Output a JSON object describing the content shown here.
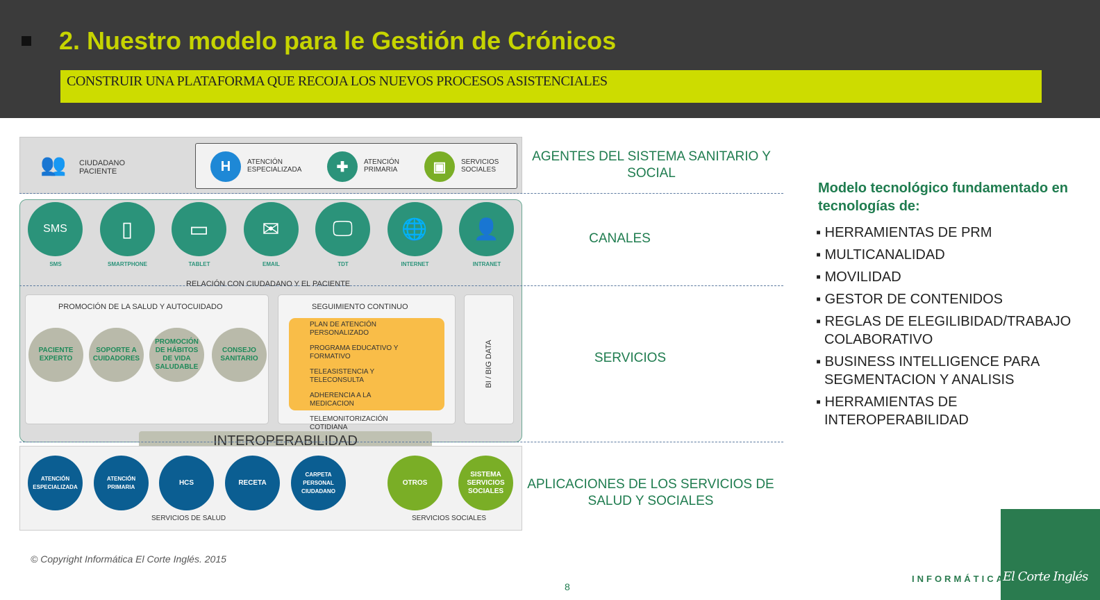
{
  "header": {
    "title": "2. Nuestro modelo para le Gestión de Crónicos",
    "subtitle": "CONSTRUIR UNA PLATAFORMA QUE RECOJA LOS NUEVOS PROCESOS ASISTENCIALES"
  },
  "agents": {
    "citizen": "CIUDADANO PACIENTE",
    "items": [
      {
        "label": "ATENCIÓN ESPECIALIZADA",
        "icon": "hospital-icon",
        "color": "#1e88d6"
      },
      {
        "label": "ATENCIÓN PRIMARIA",
        "icon": "medical-kit-icon",
        "color": "#2b937a"
      },
      {
        "label": "SERVICIOS SOCIALES",
        "icon": "social-services-icon",
        "color": "#7aae26"
      }
    ]
  },
  "channels": {
    "items": [
      {
        "label": "SMS",
        "icon": "sms-icon",
        "glyph": "SMS"
      },
      {
        "label": "SMARTPHONE",
        "icon": "smartphone-icon",
        "glyph": "▯"
      },
      {
        "label": "TABLET",
        "icon": "tablet-icon",
        "glyph": "▭"
      },
      {
        "label": "EMAIL",
        "icon": "email-icon",
        "glyph": "✉"
      },
      {
        "label": "TDT",
        "icon": "tv-icon",
        "glyph": "🖵"
      },
      {
        "label": "INTERNET",
        "icon": "globe-icon",
        "glyph": "🌐"
      },
      {
        "label": "INTRANET",
        "icon": "intranet-icon",
        "glyph": "👤"
      }
    ],
    "relation": "RELACIÓN CON CIUDADANO Y EL PACIENTE"
  },
  "services": {
    "promotion": {
      "title": "PROMOCIÓN DE LA SALUD Y AUTOCUIDADO",
      "items": [
        "PACIENTE EXPERTO",
        "SOPORTE A CUIDADORES",
        "PROMOCIÓN DE HÁBITOS DE VIDA SALUDABLE",
        "CONSEJO SANITARIO"
      ]
    },
    "followup": {
      "title": "SEGUIMIENTO CONTINUO",
      "items": [
        "PLAN DE ATENCIÓN PERSONALIZADO",
        "PROGRAMA EDUCATIVO Y FORMATIVO",
        "TELEASISTENCIA Y TELECONSULTA",
        "ADHERENCIA A LA MEDICACION",
        "TELEMONITORIZACIÓN COTIDIANA"
      ]
    },
    "bi": "BI / BIG DATA",
    "interop": "INTEROPERABILIDAD"
  },
  "applications": {
    "health": [
      "ATENCIÓN ESPECIALIZADA",
      "ATENCIÓN PRIMARIA",
      "HCS",
      "RECETA",
      "CARPETA PERSONAL CIUDADANO"
    ],
    "social": [
      "OTROS",
      "SISTEMA SERVICIOS SOCIALES"
    ],
    "health_label": "SERVICIOS DE SALUD",
    "social_label": "SERVICIOS SOCIALES"
  },
  "side_labels": {
    "agents": "AGENTES DEL SISTEMA SANITARIO Y SOCIAL",
    "channels": "CANALES",
    "services": "SERVICIOS",
    "apps": "APLICACIONES DE LOS SERVICIOS DE SALUD Y SOCIALES"
  },
  "tech": {
    "heading": "Modelo tecnológico fundamentado en tecnologías de:",
    "items": [
      "HERRAMIENTAS DE PRM",
      "MULTICANALIDAD",
      "MOVILIDAD",
      "GESTOR DE CONTENIDOS",
      "REGLAS DE ELEGILIBIDAD/TRABAJO COLABORATIVO",
      "BUSINESS INTELLIGENCE PARA SEGMENTACION Y ANALISIS",
      "HERRAMIENTAS DE INTEROPERABILIDAD"
    ]
  },
  "footer": {
    "copyright": "© Copyright Informática El Corte Inglés. 2015",
    "page": "8",
    "logo_text": "INFORMÁTICA",
    "logo_brand": "El Corte Inglés"
  }
}
